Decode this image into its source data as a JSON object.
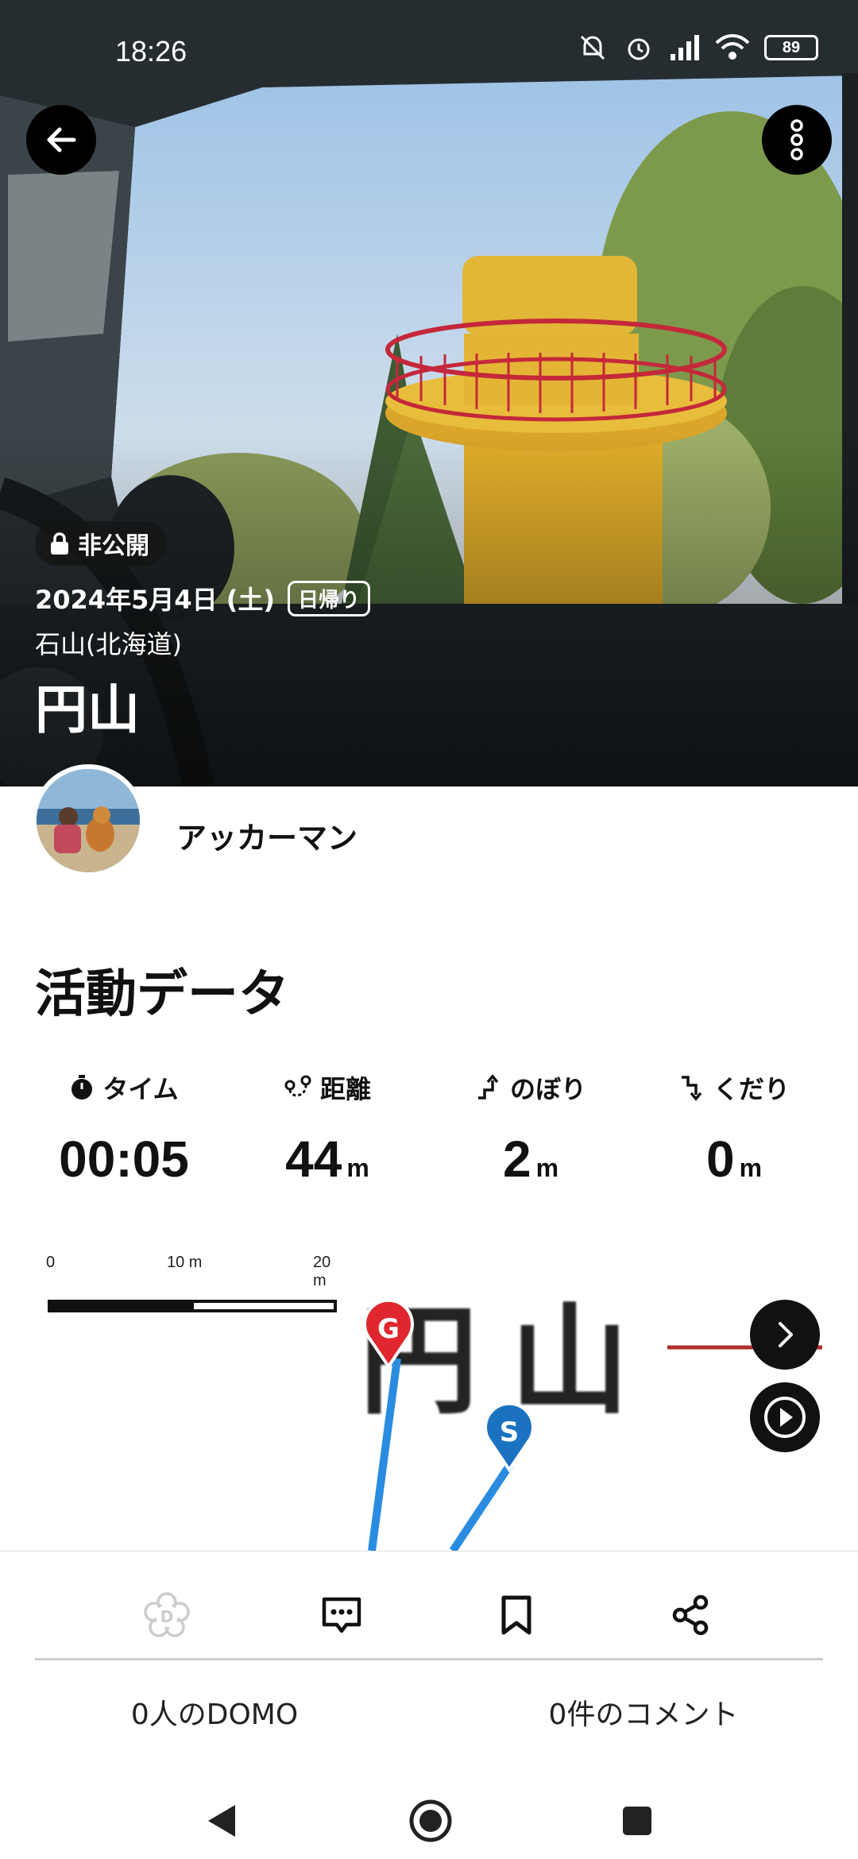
{
  "status_bar": {
    "time": "18:26",
    "battery": "89"
  },
  "header": {
    "privacy_label": "非公開",
    "date": "2024年5月4日 (土)",
    "trip_type": "日帰り",
    "area": "石山(北海道)",
    "title": "円山"
  },
  "user": {
    "name": "アッカーマン"
  },
  "activity": {
    "title": "活動データ",
    "stats": [
      {
        "label": "タイム",
        "value": "00:05",
        "unit": "",
        "icon": "stopwatch-icon"
      },
      {
        "label": "距離",
        "value": "44",
        "unit": "m",
        "icon": "distance-icon"
      },
      {
        "label": "のぼり",
        "value": "2",
        "unit": "m",
        "icon": "ascent-icon"
      },
      {
        "label": "くだり",
        "value": "0",
        "unit": "m",
        "icon": "descent-icon"
      }
    ]
  },
  "map": {
    "scale_labels": [
      "0",
      "10 m",
      "20 m"
    ],
    "place_label": "円山",
    "goal_marker": "G",
    "start_marker": "S",
    "track_color": "#2a8ce0"
  },
  "social": {
    "domo_count": "0人のDOMO",
    "comment_count": "0件のコメント"
  },
  "colors": {
    "goal": "#e0262e",
    "start": "#1a72c0"
  }
}
